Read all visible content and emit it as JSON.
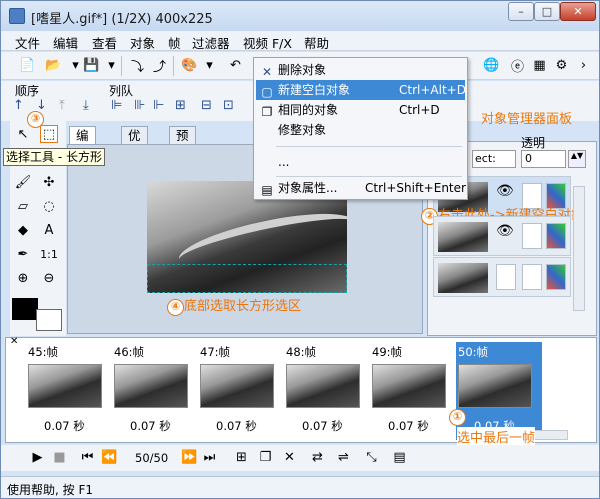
{
  "window": {
    "title": "[嗜星人.gif*] (1/2X)  400x225",
    "min_label": "–",
    "max_label": "□",
    "close_label": "✕"
  },
  "menubar": [
    "文件",
    "编辑",
    "查看",
    "对象",
    "帧",
    "过滤器",
    "视频 F/X",
    "帮助"
  ],
  "sections": {
    "order": "顺序",
    "queue": "列队",
    "obj_manager": "对象管理器面板",
    "transparency": "透明"
  },
  "tabs": [
    "编辑",
    "优化",
    "预览"
  ],
  "context_menu": [
    {
      "label": "删除对象",
      "shortcut": "",
      "icon": "delete-x-icon"
    },
    {
      "label": "新建空白对象",
      "shortcut": "Ctrl+Alt+D",
      "icon": "new-object-icon",
      "highlighted": true
    },
    {
      "label": "相同的对象",
      "shortcut": "Ctrl+D",
      "icon": "duplicate-icon"
    },
    {
      "label": "修整对象",
      "shortcut": "",
      "icon": ""
    },
    {
      "label": "...",
      "shortcut": "",
      "icon": ""
    },
    {
      "label": "对象属性...",
      "shortcut": "Ctrl+Shift+Enter",
      "icon": "properties-icon"
    }
  ],
  "select_label": "ect:",
  "transparency_value": "0",
  "annotations": {
    "a1": "①",
    "a1_text": "选中最后一帧",
    "a2": "②",
    "a2_text": "右击此处->新建空白对象",
    "a3": "③",
    "a4": "④",
    "a4_text": "底部选取长方形选区"
  },
  "tooltip": "选择工具 - 长方形",
  "tool_labels": {
    "one_to_one": "1:1"
  },
  "frames": [
    {
      "label": "45:帧",
      "delay": "0.07 秒"
    },
    {
      "label": "46:帧",
      "delay": "0.07 秒"
    },
    {
      "label": "47:帧",
      "delay": "0.07 秒"
    },
    {
      "label": "48:帧",
      "delay": "0.07 秒"
    },
    {
      "label": "49:帧",
      "delay": "0.07 秒"
    },
    {
      "label": "50:帧",
      "delay": "0.07 秒",
      "active": true
    }
  ],
  "frame_counter": "50/50",
  "status": "使用帮助, 按 F1",
  "colors": {
    "accent": "#3d89d6",
    "annotation": "#e8770f",
    "selection": "#15a5a5"
  }
}
